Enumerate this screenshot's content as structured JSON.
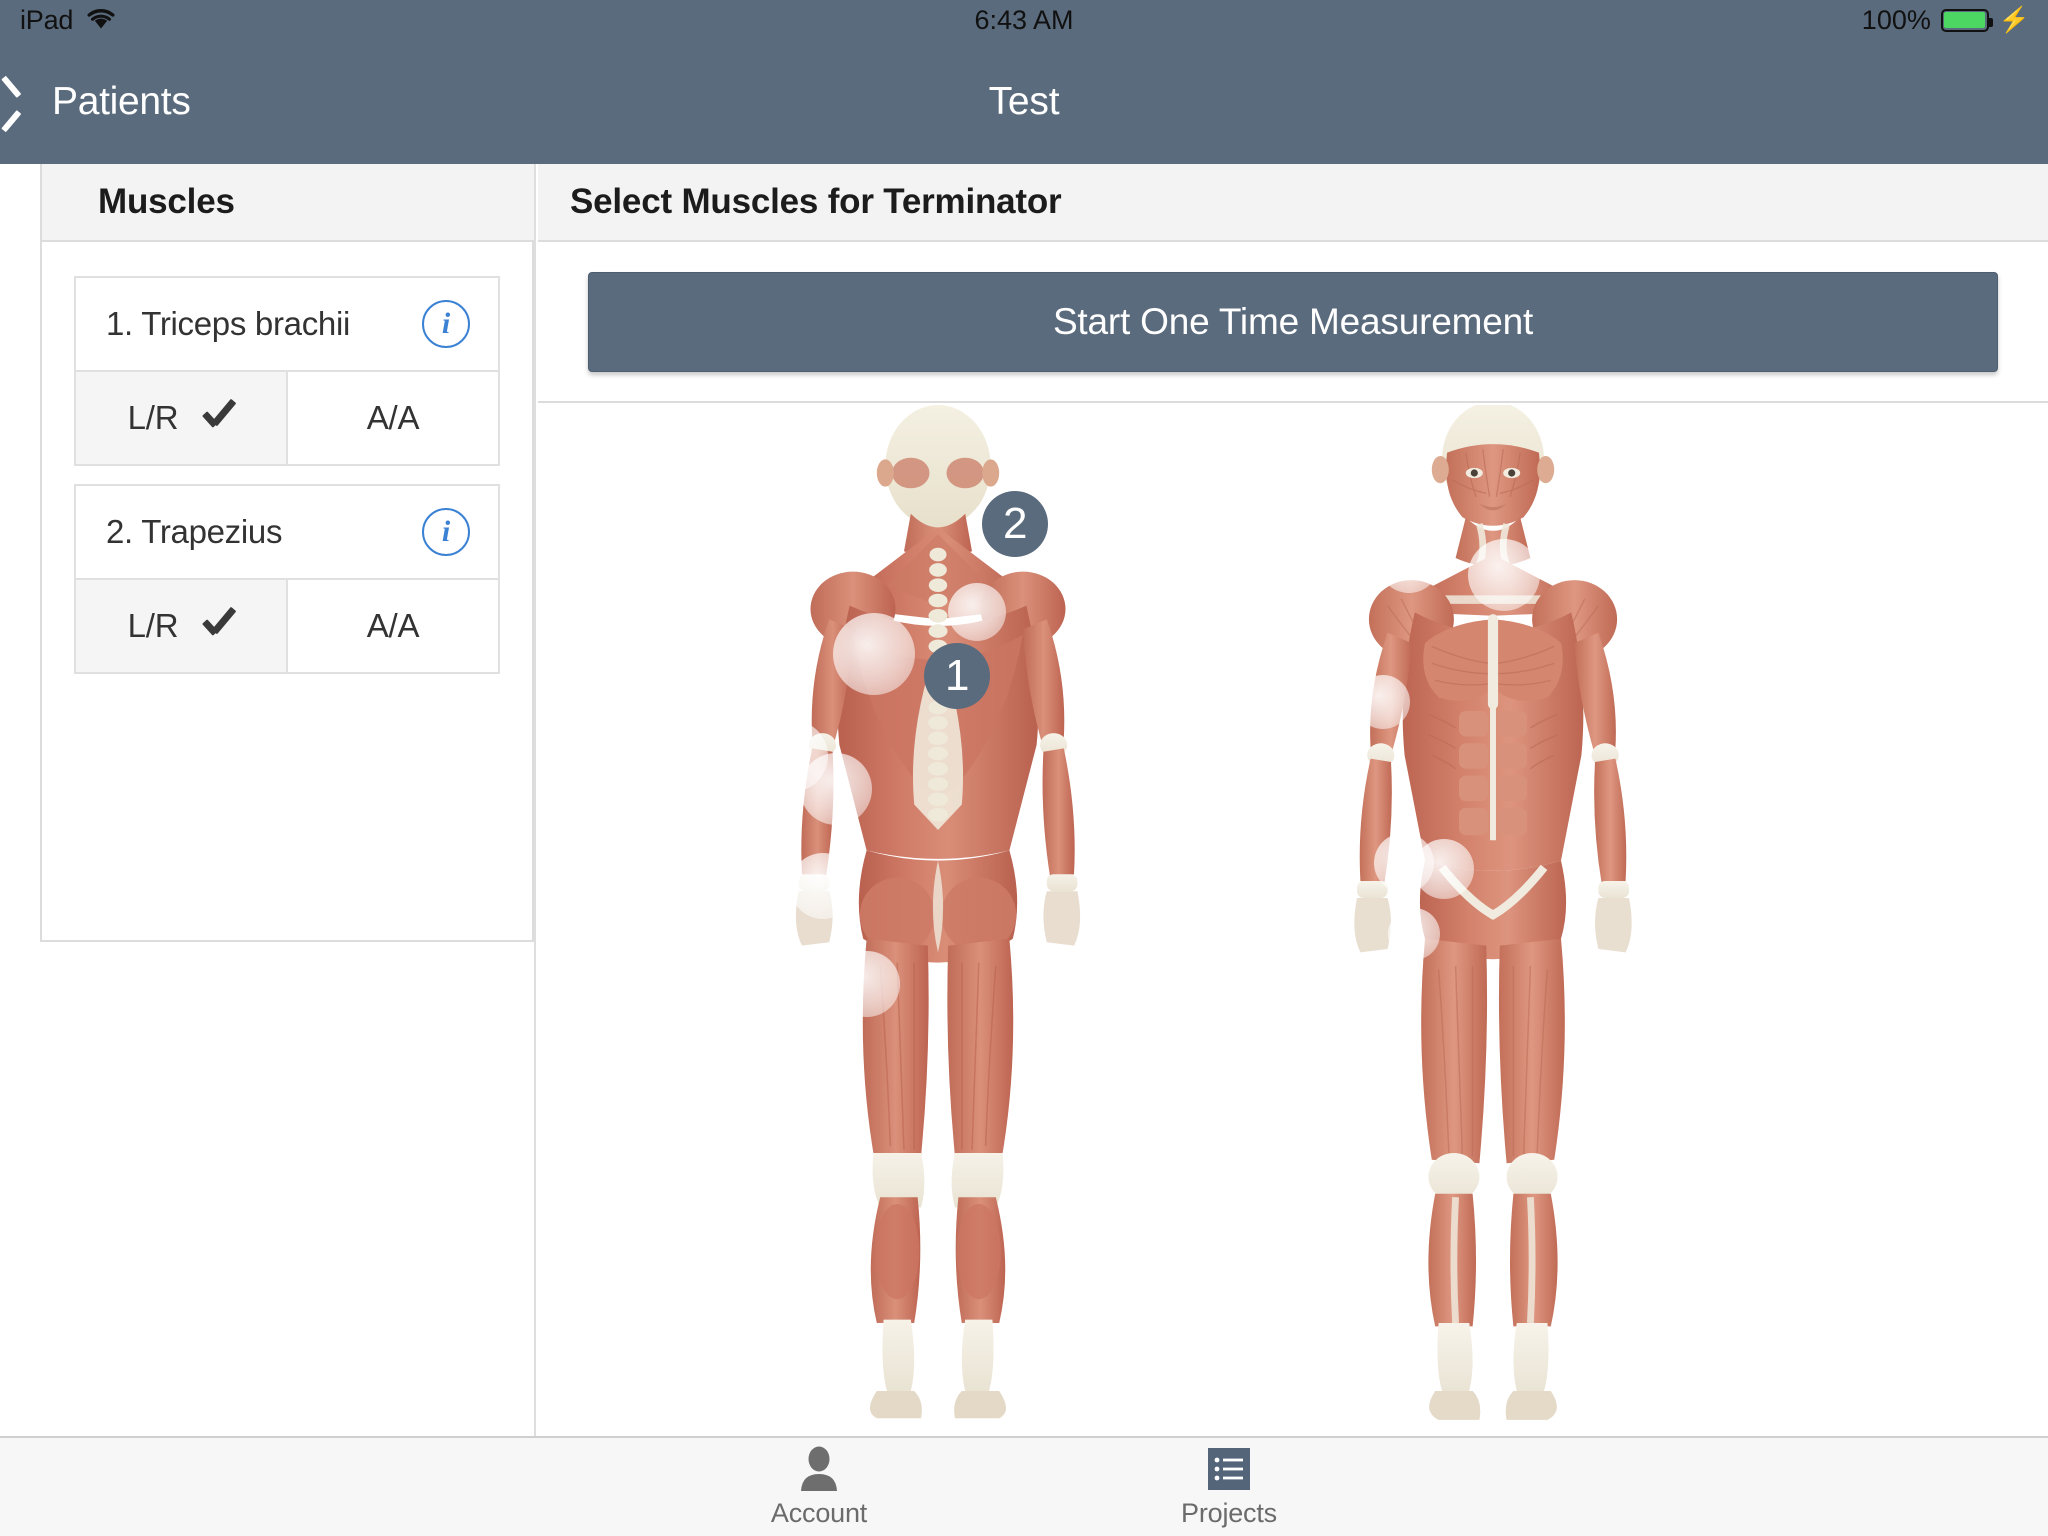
{
  "statusbar": {
    "carrier": "iPad",
    "wifi_icon": "wifi-icon",
    "time": "6:43 AM",
    "battery_percent": "100%",
    "battery_icon": "battery-icon",
    "charging_icon": "lightning-bolt-icon",
    "battery_color": "#4cd662",
    "bar_color": "#5a6b7d"
  },
  "navbar": {
    "back_icon": "chevron-left-icon",
    "back_label": "Patients",
    "title": "Test",
    "color": "#5a6b7d"
  },
  "sidebar": {
    "header_title": "Muscles",
    "muscles": [
      {
        "name": "1. Triceps brachii",
        "info_icon": "info-circle-icon",
        "modes": [
          {
            "label": "L/R",
            "selected": true,
            "check_icon": "checkmark-icon"
          },
          {
            "label": "A/A",
            "selected": false
          }
        ]
      },
      {
        "name": "2. Trapezius",
        "info_icon": "info-circle-icon",
        "modes": [
          {
            "label": "L/R",
            "selected": true,
            "check_icon": "checkmark-icon"
          },
          {
            "label": "A/A",
            "selected": false
          }
        ]
      }
    ]
  },
  "main": {
    "header_title": "Select Muscles for Terminator",
    "action_button_label": "Start One Time Measurement",
    "action_button_color": "#5a6b7d",
    "anatomy": {
      "views": [
        {
          "name": "posterior-body-view"
        },
        {
          "name": "anterior-body-view"
        }
      ],
      "markers": [
        {
          "label": "1",
          "muscle": "Triceps brachii"
        },
        {
          "label": "2",
          "muscle": "Trapezius"
        }
      ],
      "marker_color": "#5a6b7d"
    }
  },
  "tabbar": {
    "tabs": [
      {
        "label": "Account",
        "icon": "person-icon",
        "active": false
      },
      {
        "label": "Projects",
        "icon": "list-icon",
        "active": true
      }
    ],
    "active_color": "#5a6b7d"
  }
}
